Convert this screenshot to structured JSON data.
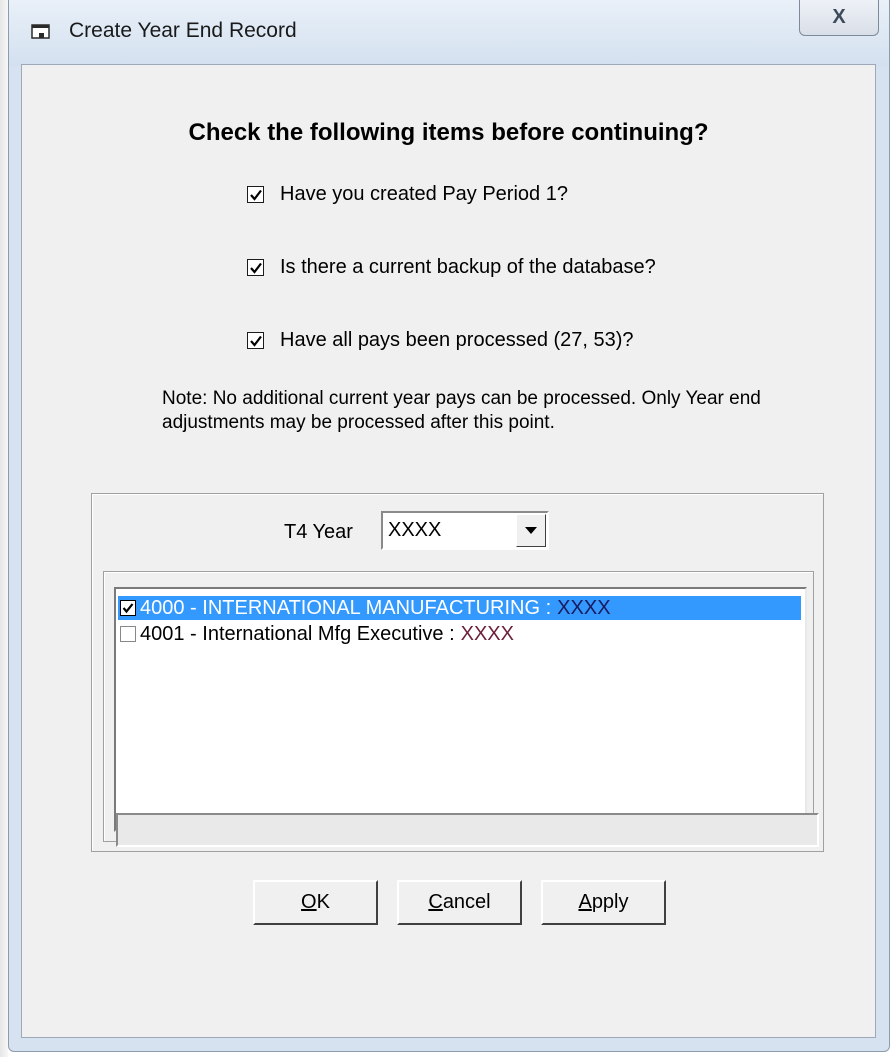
{
  "window": {
    "title": "Create Year End Record",
    "close_glyph": "X"
  },
  "dialog": {
    "heading": "Check the following items before continuing?",
    "checks": [
      {
        "label": "Have you created Pay Period 1?",
        "checked": true
      },
      {
        "label": "Is there a current backup of the database?",
        "checked": true
      },
      {
        "label": "Have all pays been processed (27, 53)?",
        "checked": true
      }
    ],
    "note": "Note: No additional current year pays can be processed. Only Year end adjustments may be processed after this point.",
    "t4_label": "T4 Year",
    "t4_value": "XXXX",
    "companies": [
      {
        "name": "4000 - INTERNATIONAL MANUFACTURING  :",
        "year": "XXXX",
        "checked": true,
        "selected": true
      },
      {
        "name": "4001 - International Mfg Executive  :",
        "year": "XXXX",
        "checked": false,
        "selected": false
      }
    ],
    "buttons": {
      "ok_accel": "O",
      "ok_rest": "K",
      "cancel_accel": "C",
      "cancel_rest": "ancel",
      "apply_accel": "A",
      "apply_rest": "pply"
    }
  },
  "colors": {
    "selection": "#3399ff",
    "window_frame": "#d6e2f0",
    "dialog_face": "#f0f0f0"
  },
  "icons": {
    "title": "window-app-icon",
    "close": "close-icon",
    "combo": "chevron-down-icon",
    "check": "checkmark-icon"
  }
}
